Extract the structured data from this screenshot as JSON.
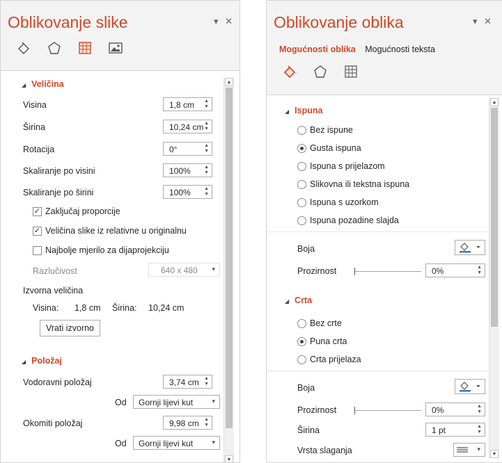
{
  "left": {
    "title": "Oblikovanje slike",
    "controls": {
      "menu": "▾",
      "close": "✕"
    },
    "icons": [
      "fill-line-icon",
      "effects-icon",
      "size-properties-icon",
      "picture-icon"
    ],
    "size_section": "Veličina",
    "height_label": "Visina",
    "height_value": "1,8 cm",
    "width_label": "Širina",
    "width_value": "10,24 cm",
    "rotation_label": "Rotacija",
    "rotation_value": "0°",
    "scale_h_label": "Skaliranje po visini",
    "scale_h_value": "100%",
    "scale_w_label": "Skaliranje po širini",
    "scale_w_value": "100%",
    "lock_label": "Zaključaj proporcije",
    "relative_label": "Veličina slike iz relativne u originalnu",
    "best_scale_label": "Najbolje mjerilo za dijaprojekciju",
    "resolution_label": "Razlučivost",
    "resolution_value": "640 x 480",
    "original_size_label": "Izvorna veličina",
    "orig_height_label": "Visina:",
    "orig_height_value": "1,8 cm",
    "orig_width_label": "Širina:",
    "orig_width_value": "10,24 cm",
    "reset_button": "Vrati izvorno",
    "position_section": "Položaj",
    "horiz_label": "Vodoravni položaj",
    "horiz_value": "3,74 cm",
    "from_label": "Od",
    "from_value": "Gornji lijevi kut",
    "vert_label": "Okomiti položaj",
    "vert_value": "9,98 cm",
    "from_label2": "Od",
    "from_value2": "Gornji lijevi kut"
  },
  "right": {
    "title": "Oblikovanje oblika",
    "controls": {
      "menu": "▾",
      "close": "✕"
    },
    "tab_shape": "Mogućnosti oblika",
    "tab_text": "Mogućnosti teksta",
    "fill_section": "Ispuna",
    "fill_options": [
      "Bez ispune",
      "Gusta ispuna",
      "Ispuna s prijelazom",
      "Slikovna ili tekstna ispuna",
      "Ispuna s uzorkom",
      "Ispuna pozadine slajda"
    ],
    "fill_color_label": "Boja",
    "fill_transparency_label": "Prozirnost",
    "fill_transparency_value": "0%",
    "line_section": "Crta",
    "line_options": [
      "Bez crte",
      "Puna crta",
      "Crta prijelaza"
    ],
    "line_color_label": "Boja",
    "line_transparency_label": "Prozirnost",
    "line_transparency_value": "0%",
    "line_width_label": "Širina",
    "line_width_value": "1 pt",
    "compound_label": "Vrsta slaganja"
  }
}
